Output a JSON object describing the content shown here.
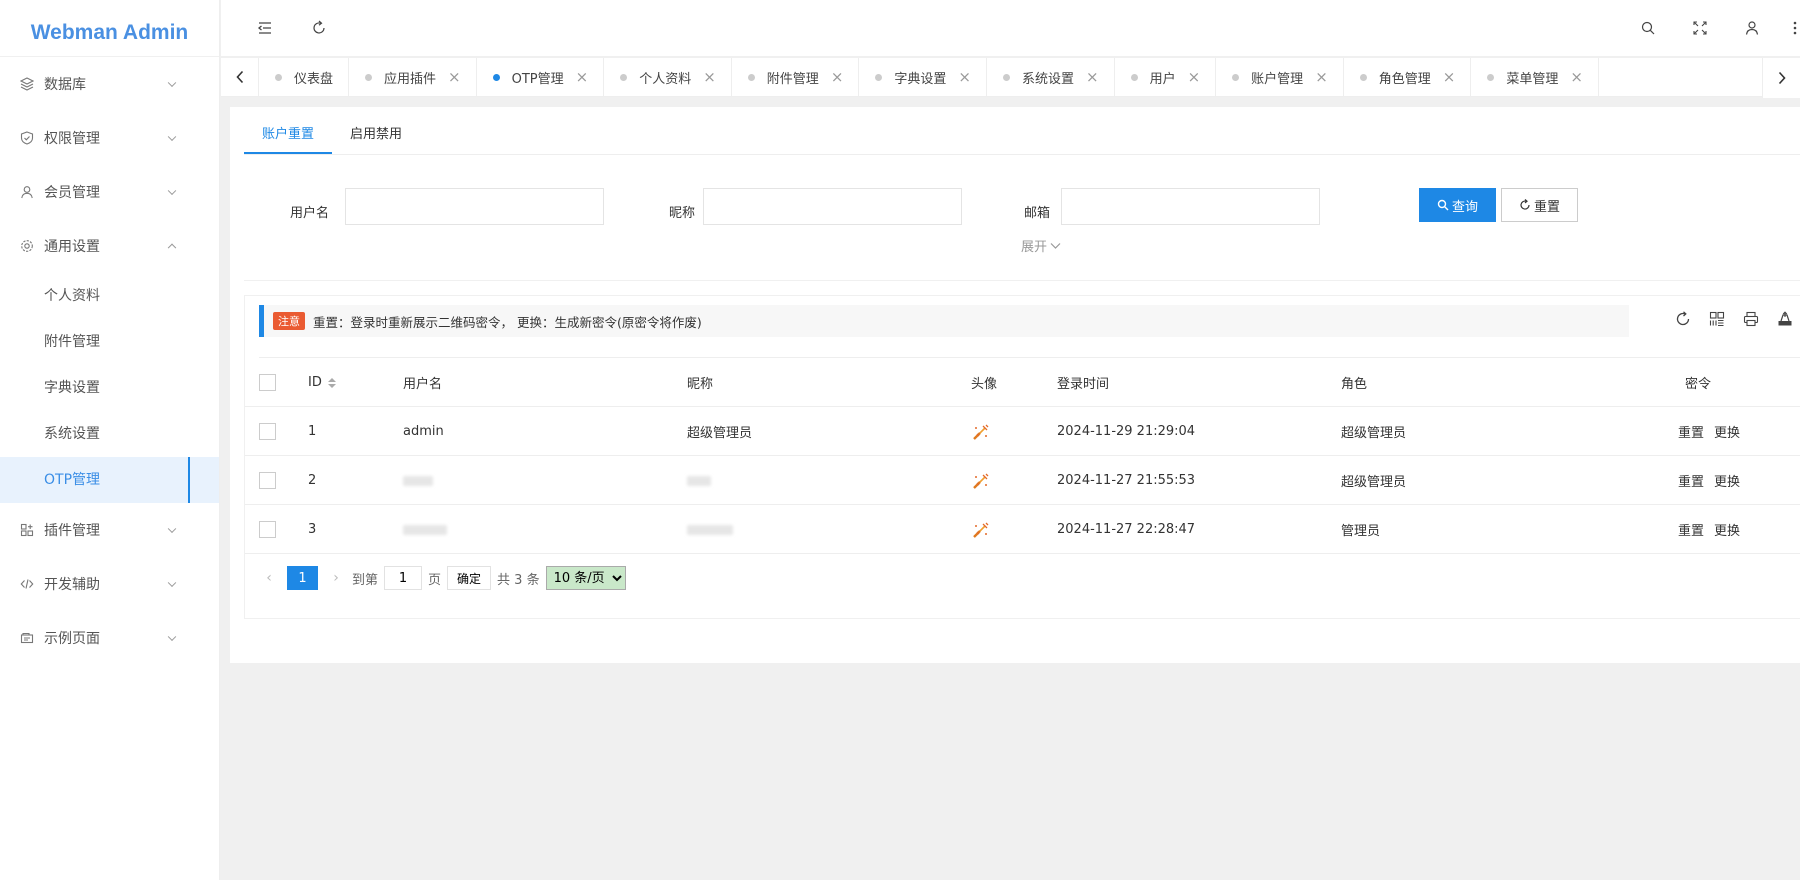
{
  "app": {
    "title": "Webman Admin"
  },
  "sidebar": {
    "items": [
      {
        "label": "数据库",
        "icon": "database-icon",
        "expanded": false
      },
      {
        "label": "权限管理",
        "icon": "shield-icon",
        "expanded": false
      },
      {
        "label": "会员管理",
        "icon": "user-icon",
        "expanded": false
      },
      {
        "label": "通用设置",
        "icon": "gear-icon",
        "expanded": true,
        "children": [
          {
            "label": "个人资料"
          },
          {
            "label": "附件管理"
          },
          {
            "label": "字典设置"
          },
          {
            "label": "系统设置"
          },
          {
            "label": "OTP管理",
            "active": true
          }
        ]
      },
      {
        "label": "插件管理",
        "icon": "plugin-icon",
        "expanded": false
      },
      {
        "label": "开发辅助",
        "icon": "code-icon",
        "expanded": false
      },
      {
        "label": "示例页面",
        "icon": "page-icon",
        "expanded": false
      }
    ]
  },
  "tabs": [
    {
      "label": "仪表盘",
      "closable": false
    },
    {
      "label": "应用插件",
      "closable": true
    },
    {
      "label": "OTP管理",
      "closable": true,
      "active": true
    },
    {
      "label": "个人资料",
      "closable": true
    },
    {
      "label": "附件管理",
      "closable": true
    },
    {
      "label": "字典设置",
      "closable": true
    },
    {
      "label": "系统设置",
      "closable": true
    },
    {
      "label": "用户",
      "closable": true
    },
    {
      "label": "账户管理",
      "closable": true
    },
    {
      "label": "角色管理",
      "closable": true
    },
    {
      "label": "菜单管理",
      "closable": true
    }
  ],
  "subtabs": [
    {
      "label": "账户重置",
      "active": true
    },
    {
      "label": "启用禁用"
    }
  ],
  "search": {
    "username_label": "用户名",
    "nickname_label": "昵称",
    "email_label": "邮箱",
    "username_value": "",
    "nickname_value": "",
    "email_value": "",
    "query_button": "查询",
    "reset_button": "重置",
    "expand_label": "展开"
  },
  "notice": {
    "badge": "注意",
    "text": "重置：登录时重新展示二维码密令， 更换：生成新密令(原密令将作废)"
  },
  "table": {
    "headers": {
      "id": "ID",
      "username": "用户名",
      "nickname": "昵称",
      "avatar": "头像",
      "login_time": "登录时间",
      "role": "角色",
      "secret": "密令"
    },
    "rows": [
      {
        "id": "1",
        "username": "admin",
        "nickname": "超级管理员",
        "login_time": "2024-11-29 21:29:04",
        "role": "超级管理员",
        "action_reset": "重置",
        "action_change": "更换"
      },
      {
        "id": "2",
        "username": "",
        "nickname": "",
        "login_time": "2024-11-27 21:55:53",
        "role": "超级管理员",
        "action_reset": "重置",
        "action_change": "更换"
      },
      {
        "id": "3",
        "username": "",
        "nickname": "",
        "login_time": "2024-11-27 22:28:47",
        "role": "管理员",
        "action_reset": "重置",
        "action_change": "更换"
      }
    ]
  },
  "pagination": {
    "current_page": "1",
    "goto_label": "到第",
    "goto_value": "1",
    "page_unit": "页",
    "confirm_button": "确定",
    "total_text": "共 3 条",
    "page_size": "10 条/页"
  },
  "colors": {
    "accent": "#1e88e5",
    "brand": "#4a90e2",
    "notice_badge": "#ea5b32"
  }
}
